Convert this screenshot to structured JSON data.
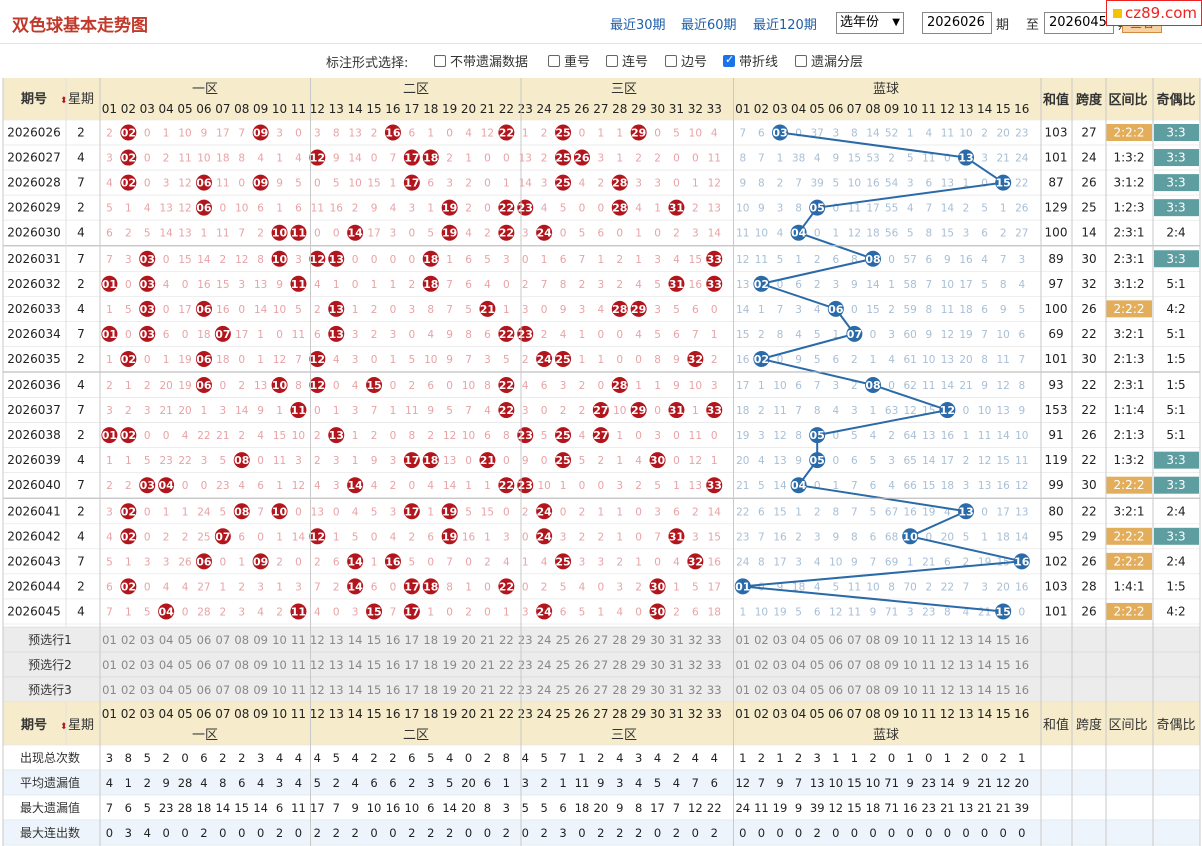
{
  "page": {
    "title": "双色球基本走势图"
  },
  "range_links": [
    "最近30期",
    "最近60期",
    "最近120期"
  ],
  "year_select": "选年份",
  "period_from": "2026026",
  "period_from_label": "期",
  "to_label": "至",
  "period_to": "2026045",
  "period_to_label": "期",
  "query_button": "查看",
  "logo": "cz89.com",
  "options": {
    "label": "标注形式选择:",
    "items": [
      {
        "label": "不带遗漏数据",
        "checked": false
      },
      {
        "label": "重号",
        "checked": false
      },
      {
        "label": "连号",
        "checked": false
      },
      {
        "label": "边号",
        "checked": false
      },
      {
        "label": "带折线",
        "checked": true
      },
      {
        "label": "遗漏分层",
        "checked": false
      }
    ]
  },
  "header": {
    "period": "期号",
    "weekday": "星期",
    "zones": [
      "一区",
      "二区",
      "三区"
    ],
    "blue": "蓝球",
    "sum": "和值",
    "span": "跨度",
    "zone_ratio": "区间比",
    "odd_even": "奇偶比"
  },
  "colors": {
    "red": "#b3151c",
    "blue": "#2a6aa8",
    "teal": "#5f9ea0",
    "orange": "#e3ae5c",
    "header_bg": "#f6eccc"
  },
  "rows": [
    {
      "period": "2026026",
      "weekday": "2",
      "red": [
        2,
        9,
        16,
        22,
        25,
        29
      ],
      "blue": 3,
      "sum": "103",
      "span": "27",
      "zone_ratio": "2:2:2",
      "odd_even": "3:3",
      "red_miss": "2,0,1,10,9,17,7,3,0,3,8,13,2,6,1,0,4,12,1,2,0,1,1,0,5,10,4,0,5,5,4,18",
      "blue_miss": "7,6,0,37,3,8,14,52,1,4,11,10,2,20,23"
    },
    {
      "period": "2026027",
      "weekday": "4",
      "red": [
        2,
        12,
        17,
        18,
        25,
        26
      ],
      "blue": 13,
      "sum": "101",
      "span": "24",
      "zone_ratio": "1:3:2",
      "odd_even": "3:3",
      "red_miss": "3,0,2,11,10,18,8,4,1,4,9,14,0,7,2,1,0,0,13,2,3,1,2,2,0,0,11,5,1,6,6,5,19",
      "blue_miss": "8,7,1,38,4,9,15,53,2,5,11,0,3,21,24"
    },
    {
      "period": "2026028",
      "weekday": "7",
      "red": [
        2,
        6,
        9,
        17,
        25,
        28
      ],
      "blue": 15,
      "sum": "87",
      "span": "26",
      "zone_ratio": "3:1:2",
      "odd_even": "3:3",
      "red_miss": "4,0,3,12,11,0,9,5,0,5,10,15,1,6,3,2,0,1,14,3,4,2,3,3,0,1,12,0,2,7,7,6,20",
      "blue_miss": "9,8,2,7,39,5,10,16,54,3,6,13,1,0,22,25"
    },
    {
      "period": "2026029",
      "weekday": "2",
      "red": [
        6,
        19,
        22,
        23,
        28,
        31
      ],
      "blue": 5,
      "sum": "129",
      "span": "25",
      "zone_ratio": "1:2:3",
      "odd_even": "3:3",
      "red_miss": "5,1,4,13,12,0,10,6,1,6,11,16,2,9,4,3,1,2,0,4,5,0,0,4,1,2,13,0,3,8,0,7,21",
      "blue_miss": "10,9,3,8,0,11,17,55,4,7,14,2,5,1,26"
    },
    {
      "period": "2026030",
      "weekday": "4",
      "red": [
        10,
        11,
        14,
        19,
        22,
        24
      ],
      "blue": 4,
      "sum": "100",
      "span": "14",
      "zone_ratio": "2:3:1",
      "odd_even": "2:4",
      "red_miss": "6,2,5,14,13,1,11,7,2,0,0,17,3,0,5,4,2,3,0,5,6,0,1,0,2,3,14,1,4,9,1,8,22",
      "blue_miss": "11,10,4,0,1,12,18,56,5,8,15,3,6,2,27"
    },
    {
      "period": "2026031",
      "weekday": "7",
      "red": [
        3,
        10,
        12,
        13,
        18,
        33
      ],
      "blue": 8,
      "sum": "89",
      "span": "30",
      "zone_ratio": "2:3:1",
      "odd_even": "3:3",
      "red_miss": "7,3,0,15,14,2,12,8,3,0,0,0,0,1,6,5,3,0,1,6,7,1,2,1,3,4,15,2,5,10,2,9,0",
      "blue_miss": "12,11,5,1,2,6,8,0,57,6,9,16,4,7,3,28"
    },
    {
      "period": "2026032",
      "weekday": "2",
      "red": [
        1,
        3,
        11,
        18,
        31,
        33
      ],
      "blue": 2,
      "sum": "97",
      "span": "32",
      "zone_ratio": "3:1:2",
      "odd_even": "5:1",
      "red_miss": "0,4,0,16,15,3,13,9,4,1,0,1,1,2,7,6,4,0,2,7,8,2,3,2,4,5,16,3,6,11,0,10,0",
      "blue_miss": "13,0,6,2,3,9,14,1,58,7,10,17,5,8,4,29"
    },
    {
      "period": "2026033",
      "weekday": "4",
      "red": [
        3,
        6,
        13,
        21,
        28,
        29
      ],
      "blue": 6,
      "sum": "100",
      "span": "26",
      "zone_ratio": "2:2:2",
      "odd_even": "4:2",
      "red_miss": "1,5,0,17,16,0,14,10,5,2,1,2,0,3,8,7,5,1,3,0,9,3,4,3,5,6,0,0,7,12,1,11,1",
      "blue_miss": "14,1,7,3,4,0,15,2,59,8,11,18,6,9,5,30"
    },
    {
      "period": "2026034",
      "weekday": "7",
      "red": [
        1,
        3,
        7,
        13,
        22,
        23
      ],
      "blue": 7,
      "sum": "69",
      "span": "22",
      "zone_ratio": "3:2:1",
      "odd_even": "5:1",
      "red_miss": "0,6,0,18,17,1,0,11,6,3,2,3,0,4,9,8,6,2,4,1,0,0,4,5,6,7,1,1,8,13,2,12,2",
      "blue_miss": "15,2,8,4,5,1,0,3,60,9,12,19,7,10,6,31"
    },
    {
      "period": "2026035",
      "weekday": "2",
      "red": [
        2,
        6,
        12,
        24,
        25,
        32
      ],
      "blue": 2,
      "sum": "101",
      "span": "30",
      "zone_ratio": "2:1:3",
      "odd_even": "1:5",
      "red_miss": "1,0,1,19,18,0,1,12,7,4,3,0,1,5,10,9,7,3,5,2,1,1,0,0,8,9,2,2,14,3,0,3",
      "blue_miss": "16,0,9,5,6,2,1,4,61,10,13,20,8,11,7,32"
    },
    {
      "period": "2026036",
      "weekday": "4",
      "red": [
        6,
        10,
        12,
        15,
        22,
        28
      ],
      "blue": 8,
      "sum": "93",
      "span": "22",
      "zone_ratio": "2:3:1",
      "odd_even": "1:5",
      "red_miss": "2,1,2,20,19,0,2,13,8,0,4,0,2,6,0,10,8,4,6,3,2,0,1,1,9,10,3,0,15,4,1,4",
      "blue_miss": "17,1,10,6,7,3,2,0,62,11,14,21,9,12,8,33"
    },
    {
      "period": "2026037",
      "weekday": "7",
      "red": [
        11,
        22,
        27,
        29,
        31,
        33
      ],
      "blue": 12,
      "sum": "153",
      "span": "22",
      "zone_ratio": "1:1:4",
      "odd_even": "5:1",
      "red_miss": "3,2,3,21,20,1,3,14,9,1,0,1,3,7,1,11,9,5,7,4,3,0,2,2,10,0,1,0,1,0,2,0",
      "blue_miss": "18,2,11,7,8,4,3,1,63,12,15,0,10,13,9,34"
    },
    {
      "period": "2026038",
      "weekday": "2",
      "red": [
        1,
        2,
        13,
        23,
        25,
        27
      ],
      "blue": 5,
      "sum": "91",
      "span": "26",
      "zone_ratio": "2:1:3",
      "odd_even": "5:1",
      "red_miss": "0,0,4,22,21,2,4,15,10,2,1,2,0,8,2,12,10,6,8,5,4,1,0,3,0,11,0,1,2,1,3,1",
      "blue_miss": "19,3,12,8,0,5,4,2,64,13,16,1,11,14,10,35"
    },
    {
      "period": "2026039",
      "weekday": "4",
      "red": [
        8,
        17,
        18,
        21,
        25,
        30
      ],
      "blue": 5,
      "sum": "119",
      "span": "22",
      "zone_ratio": "1:3:2",
      "odd_even": "3:3",
      "red_miss": "1,1,5,23,22,3,5,0,11,3,2,3,1,9,3,13,0,0,9,0,5,2,1,4,0,12,1,2,0,2,4,2",
      "blue_miss": "20,4,13,9,0,6,5,3,65,14,17,2,12,15,11,36"
    },
    {
      "period": "2026040",
      "weekday": "7",
      "red": [
        3,
        4,
        14,
        22,
        23,
        33
      ],
      "blue": 4,
      "sum": "99",
      "span": "30",
      "zone_ratio": "2:2:2",
      "odd_even": "3:3",
      "red_miss": "2,2,0,0,23,4,6,1,12,4,3,4,2,0,4,14,1,1,10,1,0,0,3,2,5,1,13,2,3,1,3,5,0",
      "blue_miss": "21,5,14,0,1,7,6,4,66,15,18,3,13,16,12,37"
    },
    {
      "period": "2026041",
      "weekday": "2",
      "red": [
        2,
        8,
        10,
        17,
        19,
        24
      ],
      "blue": 13,
      "sum": "80",
      "span": "22",
      "zone_ratio": "3:2:1",
      "odd_even": "2:4",
      "red_miss": "3,0,1,1,24,5,7,0,13,0,4,5,3,1,5,15,0,2,0,2,1,1,0,3,6,2,14,3,4,2,4,6,1",
      "blue_miss": "22,6,15,1,2,8,7,5,67,16,19,4,0,17,13,38"
    },
    {
      "period": "2026042",
      "weekday": "4",
      "red": [
        2,
        7,
        12,
        19,
        24,
        31
      ],
      "blue": 10,
      "sum": "95",
      "span": "29",
      "zone_ratio": "2:2:2",
      "odd_even": "3:3",
      "red_miss": "4,0,2,2,25,6,0,1,14,1,5,0,4,2,6,16,1,3,0,3,2,2,1,0,7,3,15,4,5,0,5,7,2",
      "blue_miss": "23,7,16,2,3,9,8,6,68,0,20,5,1,18,14,39"
    },
    {
      "period": "2026043",
      "weekday": "7",
      "red": [
        6,
        9,
        14,
        16,
        25,
        32
      ],
      "blue": 16,
      "sum": "102",
      "span": "26",
      "zone_ratio": "2:2:2",
      "odd_even": "2:4",
      "red_miss": "5,1,3,3,26,0,1,2,0,2,6,1,5,0,7,0,2,4,1,4,3,3,2,1,0,4,16,5,6,1,0,8,3",
      "blue_miss": "24,8,17,3,4,10,9,7,69,1,21,6,2,19,15,0"
    },
    {
      "period": "2026044",
      "weekday": "2",
      "red": [
        2,
        14,
        17,
        18,
        22,
        30
      ],
      "blue": 1,
      "sum": "103",
      "span": "28",
      "zone_ratio": "1:4:1",
      "odd_even": "1:5",
      "red_miss": "6,0,4,4,27,1,2,3,1,3,7,2,6,0,8,1,0,0,2,5,4,0,3,2,1,5,17,6,7,0,1,9,4",
      "blue_miss": "0,9,18,4,5,11,10,8,70,2,22,7,3,20,16,1"
    },
    {
      "period": "2026045",
      "weekday": "4",
      "red": [
        4,
        11,
        15,
        17,
        24,
        30
      ],
      "blue": 15,
      "sum": "101",
      "span": "26",
      "zone_ratio": "2:2:2",
      "odd_even": "4:2",
      "red_miss": "7,1,5,0,28,2,3,4,2,4,0,3,7,1,0,2,0,1,3,6,5,1,4,0,2,6,18,7,8,0,2,10,5",
      "blue_miss": "1,10,19,5,6,12,11,9,71,3,23,8,4,21,0,2"
    }
  ],
  "presel_labels": [
    "预选行1",
    "预选行2",
    "预选行3"
  ],
  "stats": [
    {
      "label": "出现总次数",
      "values": [
        "3",
        "8",
        "5",
        "2",
        "0",
        "6",
        "2",
        "2",
        "3",
        "4",
        "4",
        "4",
        "5",
        "4",
        "2",
        "2",
        "6",
        "5",
        "4",
        "0",
        "2",
        "8",
        "4",
        "5",
        "7",
        "1",
        "2",
        "4",
        "3",
        "4",
        "2",
        "4",
        "4",
        "1",
        "2",
        "1",
        "2",
        "3",
        "1",
        "1",
        "2",
        "0",
        "1",
        "0",
        "1",
        "2",
        "0",
        "2",
        "1"
      ]
    },
    {
      "label": "平均遗漏值",
      "values": [
        "4",
        "1",
        "2",
        "9",
        "28",
        "4",
        "8",
        "6",
        "4",
        "3",
        "4",
        "5",
        "2",
        "4",
        "6",
        "6",
        "2",
        "3",
        "5",
        "20",
        "6",
        "1",
        "3",
        "2",
        "1",
        "11",
        "9",
        "3",
        "4",
        "5",
        "4",
        "7",
        "6",
        "12",
        "7",
        "9",
        "7",
        "13",
        "10",
        "15",
        "10",
        "71",
        "9",
        "23",
        "14",
        "9",
        "21",
        "12",
        "20"
      ]
    },
    {
      "label": "最大遗漏值",
      "values": [
        "7",
        "6",
        "5",
        "23",
        "28",
        "18",
        "14",
        "15",
        "14",
        "6",
        "11",
        "17",
        "7",
        "9",
        "10",
        "16",
        "10",
        "6",
        "14",
        "20",
        "8",
        "3",
        "5",
        "5",
        "6",
        "18",
        "20",
        "9",
        "8",
        "17",
        "7",
        "12",
        "22",
        "24",
        "11",
        "19",
        "9",
        "39",
        "12",
        "15",
        "18",
        "71",
        "16",
        "23",
        "21",
        "13",
        "21",
        "21",
        "39"
      ]
    },
    {
      "label": "最大连出数",
      "values": [
        "0",
        "3",
        "4",
        "0",
        "0",
        "2",
        "0",
        "0",
        "0",
        "2",
        "0",
        "2",
        "2",
        "2",
        "0",
        "0",
        "2",
        "2",
        "2",
        "0",
        "0",
        "2",
        "0",
        "2",
        "3",
        "0",
        "2",
        "2",
        "2",
        "0",
        "2",
        "0",
        "2",
        "0",
        "0",
        "0",
        "0",
        "2",
        "0",
        "0",
        "0",
        "0",
        "0",
        "0",
        "0",
        "0",
        "0",
        "0",
        "0"
      ]
    }
  ],
  "chart_data": {
    "type": "table"
  }
}
